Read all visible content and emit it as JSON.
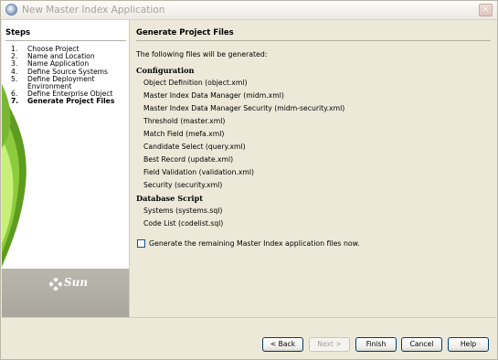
{
  "window": {
    "title": "New Master Index Application",
    "close_label": "×"
  },
  "steps": {
    "title": "Steps",
    "items": [
      {
        "num": "1.",
        "label": "Choose Project"
      },
      {
        "num": "2.",
        "label": "Name and Location"
      },
      {
        "num": "3.",
        "label": "Name Application"
      },
      {
        "num": "4.",
        "label": "Define Source Systems"
      },
      {
        "num": "5.",
        "label": "Define Deployment"
      },
      {
        "num": "",
        "label": "Environment"
      },
      {
        "num": "6.",
        "label": "Define Enterprise Object"
      },
      {
        "num": "7.",
        "label": "Generate Project Files"
      }
    ],
    "current_index": 7,
    "brand": "Sun"
  },
  "content": {
    "title": "Generate Project Files",
    "intro": "The following files will be generated:",
    "configuration": {
      "heading": "Configuration",
      "files": [
        "Object Definition (object.xml)",
        "Master Index Data Manager (midm.xml)",
        "Master Index Data Manager Security (midm-security.xml)",
        "Threshold (master.xml)",
        "Match Field (mefa.xml)",
        "Candidate Select (query.xml)",
        "Best Record (update.xml)",
        "Field Validation (validation.xml)",
        "Security (security.xml)"
      ]
    },
    "database_script": {
      "heading": "Database Script",
      "files": [
        "Systems (systems.sql)",
        "Code List (codelist.sql)"
      ]
    },
    "generate_checkbox": {
      "label": "Generate the remaining Master Index application files now.",
      "checked": false
    }
  },
  "buttons": {
    "back": "< Back",
    "next": "Next >",
    "finish": "Finish",
    "cancel": "Cancel",
    "help": "Help"
  }
}
